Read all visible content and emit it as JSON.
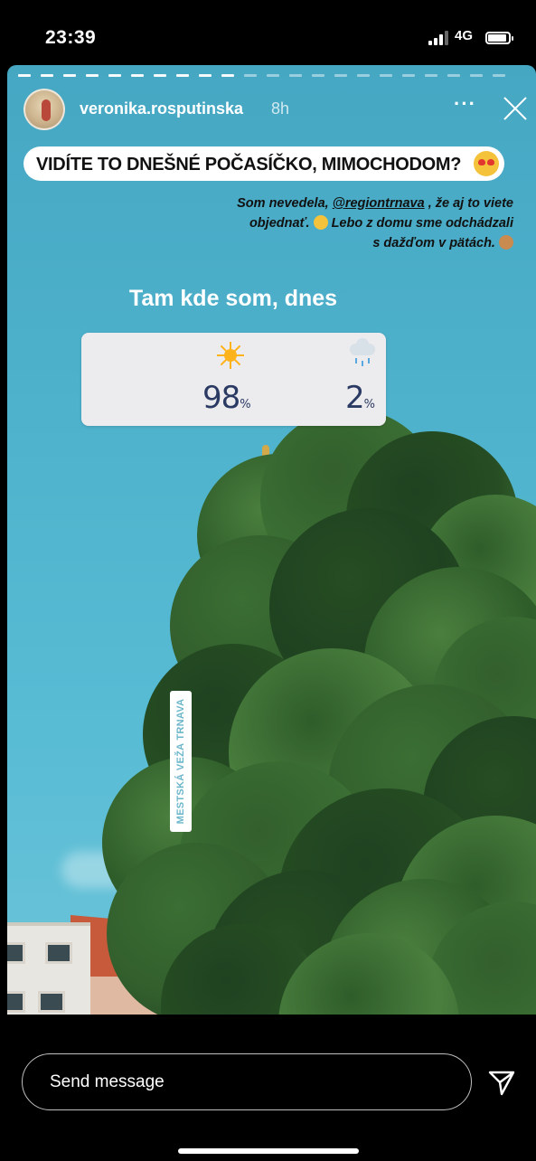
{
  "status": {
    "time": "23:39",
    "network": "4G"
  },
  "story": {
    "username": "veronika.rosputinska",
    "time_ago": "8h",
    "more_label": "···",
    "headline": "VIDÍTE TO DNEŠNÉ POČASÍČKO, MIMOCHODOM?",
    "caption": {
      "line1_pre": "Som nevedela, ",
      "mention": "@regiontrnava",
      "line1_post": " , že aj to viete",
      "line2": "objednať.",
      "line2b": " Lebo z domu sme odchádzali",
      "line3": "s dažďom v pätách."
    },
    "poll": {
      "title": "Tam kde som, dnes",
      "options": [
        {
          "icon": "sun-icon",
          "value": "98",
          "unit": "%"
        },
        {
          "icon": "rain-cloud-icon",
          "value": "2",
          "unit": "%"
        }
      ]
    },
    "location_sticker": "MESTSKÁ VEŽA TRNAVA"
  },
  "reply": {
    "placeholder": "Send message"
  },
  "colors": {
    "sky": "#4fb3cd",
    "poll_text": "#2b3a63",
    "poll_bg": "#ececef"
  }
}
